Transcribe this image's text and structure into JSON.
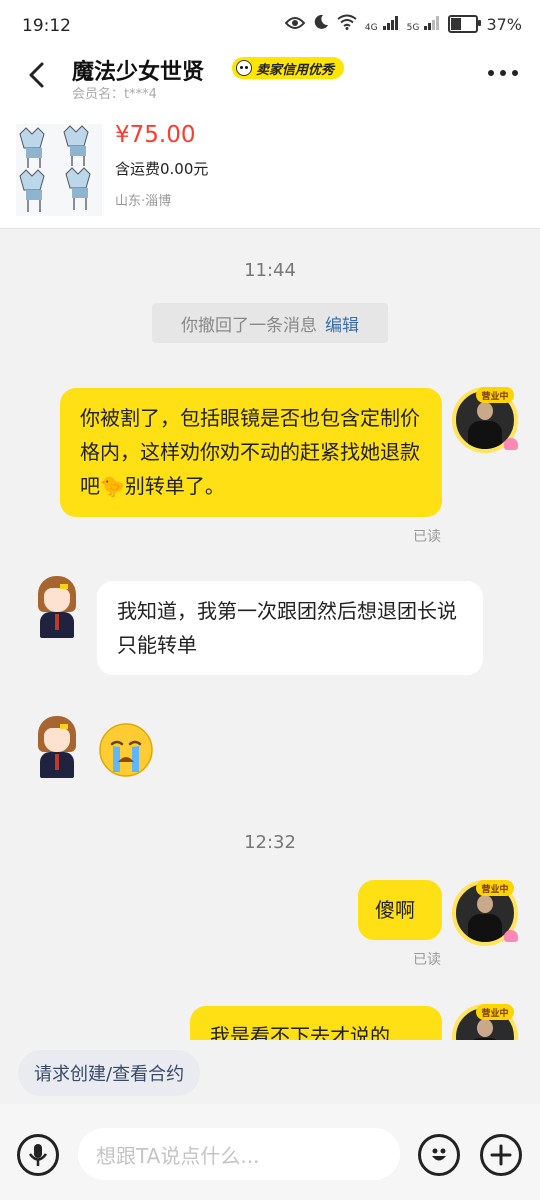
{
  "status_bar": {
    "time": "19:12",
    "network_a": "4G",
    "network_b": "5G",
    "battery": "37%",
    "battery_level": 0.37
  },
  "header": {
    "title": "魔法少女世贤",
    "badge": "卖家信用优秀",
    "member_label": "会员名：t***4"
  },
  "product": {
    "price": "¥75.00",
    "shipping": "含运费0.00元",
    "location": "山东·淄博"
  },
  "chat": {
    "time_1": "11:44",
    "recall_text": "你撤回了一条消息",
    "recall_edit": "编辑",
    "msg1_part1": "你被割了，包括眼镜是否也包含定制价格内，这样劝你劝不动的赶紧找她退款吧",
    "msg1_part2": "别转单了。",
    "msg1_emoji": "🐤",
    "read_1": "已读",
    "msg2": "我知道，我第一次跟团然后想退团长说只能转单",
    "sticker_emoji": "😭",
    "time_2": "12:32",
    "msg3": "傻啊",
    "read_2": "已读",
    "msg4_partial": "我是看不下去才说的",
    "avatar_tag": "营业中"
  },
  "contract_button": "请求创建/查看合约",
  "input": {
    "placeholder": "想跟TA说点什么..."
  },
  "colors": {
    "accent_yellow": "#ffe014",
    "price_red": "#ff3b30",
    "link_blue": "#3b6ea8"
  },
  "icons": [
    "back-icon",
    "more-icon",
    "eye-icon",
    "moon-icon",
    "wifi-icon",
    "signal-icon",
    "battery-icon",
    "mic-icon",
    "emoji-icon",
    "plus-icon"
  ]
}
